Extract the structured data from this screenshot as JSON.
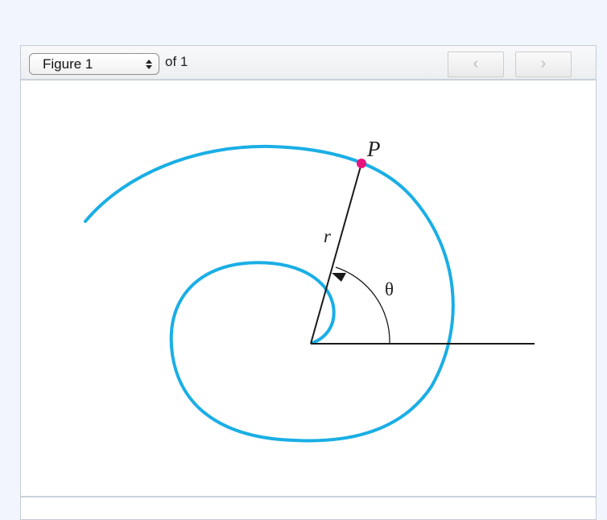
{
  "toolbar": {
    "figure_select": {
      "selected": "Figure 1"
    },
    "of_text": "of 1",
    "prev_icon": "chevron-left-icon",
    "next_icon": "chevron-right-icon",
    "prev_glyph": "‹",
    "next_glyph": "›"
  },
  "figure": {
    "labels": {
      "point": "P",
      "radius": "r",
      "angle": "θ"
    },
    "colors": {
      "spiral": "#1aaee5",
      "point": "#e8157e",
      "lines": "#1a1a1a"
    }
  }
}
